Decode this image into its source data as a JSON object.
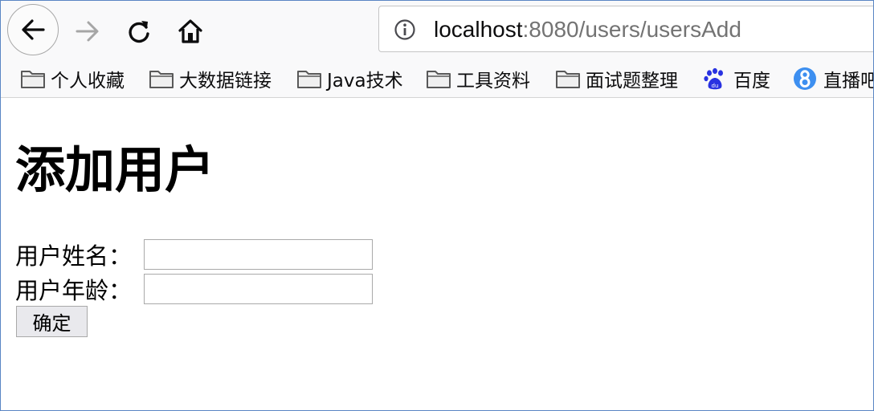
{
  "browser": {
    "url_host": "localhost",
    "url_path": ":8080/users/usersAdd"
  },
  "bookmarks": [
    {
      "label": "个人收藏",
      "icon": "folder-icon"
    },
    {
      "label": "大数据链接",
      "icon": "folder-icon"
    },
    {
      "label": "Java技术",
      "icon": "folder-icon"
    },
    {
      "label": "工具资料",
      "icon": "folder-icon"
    },
    {
      "label": "面试题整理",
      "icon": "folder-icon"
    },
    {
      "label": "百度",
      "icon": "baidu-paw-icon"
    },
    {
      "label": "直播吧",
      "icon": "zhibo8-icon"
    }
  ],
  "page": {
    "title": "添加用户",
    "fields": [
      {
        "label": "用户姓名：",
        "value": ""
      },
      {
        "label": "用户年龄：",
        "value": ""
      }
    ],
    "submit_label": "确定"
  },
  "colors": {
    "frame_border": "#5a86c4",
    "toolbar_bg": "#f9f9fa",
    "baidu_blue": "#2932e1",
    "zhibo8_blue": "#3d8ff0"
  }
}
